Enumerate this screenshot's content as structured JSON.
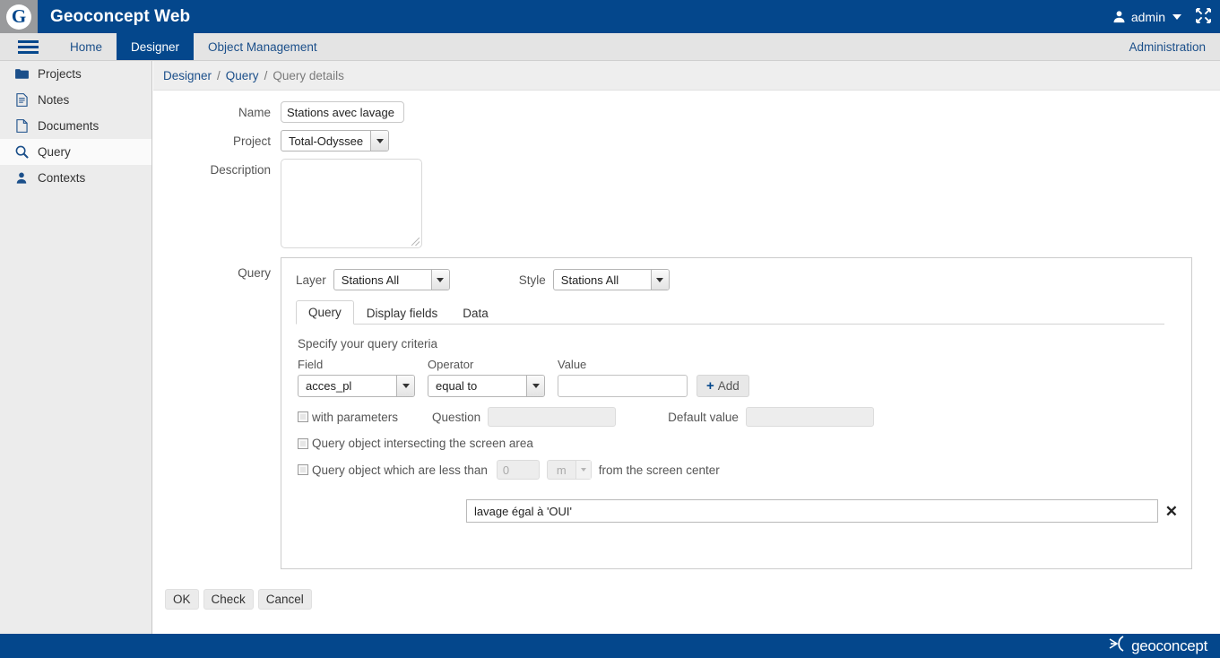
{
  "header": {
    "logo_letter": "G",
    "title": "Geoconcept Web",
    "user": "admin",
    "user_icon": "user-icon",
    "caret_icon": "chevron-down-icon",
    "expand_icon": "fullscreen-icon"
  },
  "nav": {
    "menu_icon": "hamburger-icon",
    "items": [
      {
        "label": "Home",
        "active": false
      },
      {
        "label": "Designer",
        "active": true
      },
      {
        "label": "Object Management",
        "active": false
      }
    ],
    "right_item": "Administration"
  },
  "sidebar": {
    "items": [
      {
        "label": "Projects",
        "icon": "folder-icon",
        "active": false
      },
      {
        "label": "Notes",
        "icon": "note-icon",
        "active": false
      },
      {
        "label": "Documents",
        "icon": "document-icon",
        "active": false
      },
      {
        "label": "Query",
        "icon": "search-icon",
        "active": true
      },
      {
        "label": "Contexts",
        "icon": "person-icon",
        "active": false
      }
    ]
  },
  "breadcrumb": {
    "items": [
      "Designer",
      "Query",
      "Query details"
    ],
    "separator": "/"
  },
  "form": {
    "name_label": "Name",
    "name_value": "Stations avec lavage",
    "project_label": "Project",
    "project_value": "Total-Odyssee",
    "description_label": "Description",
    "description_value": "",
    "query_label": "Query"
  },
  "query_panel": {
    "layer_label": "Layer",
    "layer_value": "Stations All",
    "style_label": "Style",
    "style_value": "Stations All",
    "tabs": [
      {
        "label": "Query",
        "active": true
      },
      {
        "label": "Display fields",
        "active": false
      },
      {
        "label": "Data",
        "active": false
      }
    ],
    "criteria_title": "Specify your query criteria",
    "field_label": "Field",
    "field_value": "acces_pl",
    "operator_label": "Operator",
    "operator_value": "equal to",
    "value_label": "Value",
    "value_value": "",
    "add_label": "Add",
    "add_icon": "plus-icon",
    "with_parameters_label": "with parameters",
    "with_parameters_checked": false,
    "question_label": "Question",
    "question_value": "",
    "default_value_label": "Default value",
    "default_value_value": "",
    "intersect_label": "Query object intersecting the screen area",
    "intersect_checked": false,
    "distance_label_before": "Query object which are less than",
    "distance_value": "0",
    "distance_unit": "m",
    "distance_label_after": "from the screen center",
    "distance_checked": false,
    "criteria_items": [
      {
        "text": "lavage égal à 'OUI'",
        "delete_icon": "close-icon"
      }
    ]
  },
  "buttons": {
    "ok": "OK",
    "check": "Check",
    "cancel": "Cancel"
  },
  "footer": {
    "brand": "geoconcept",
    "brand_mark_icon": "geoconcept-mark-icon"
  },
  "colors": {
    "brand_blue": "#04478c",
    "nav_gray": "#e4e4e4",
    "sidebar_gray": "#ececec",
    "link_blue": "#1b4f8a"
  }
}
